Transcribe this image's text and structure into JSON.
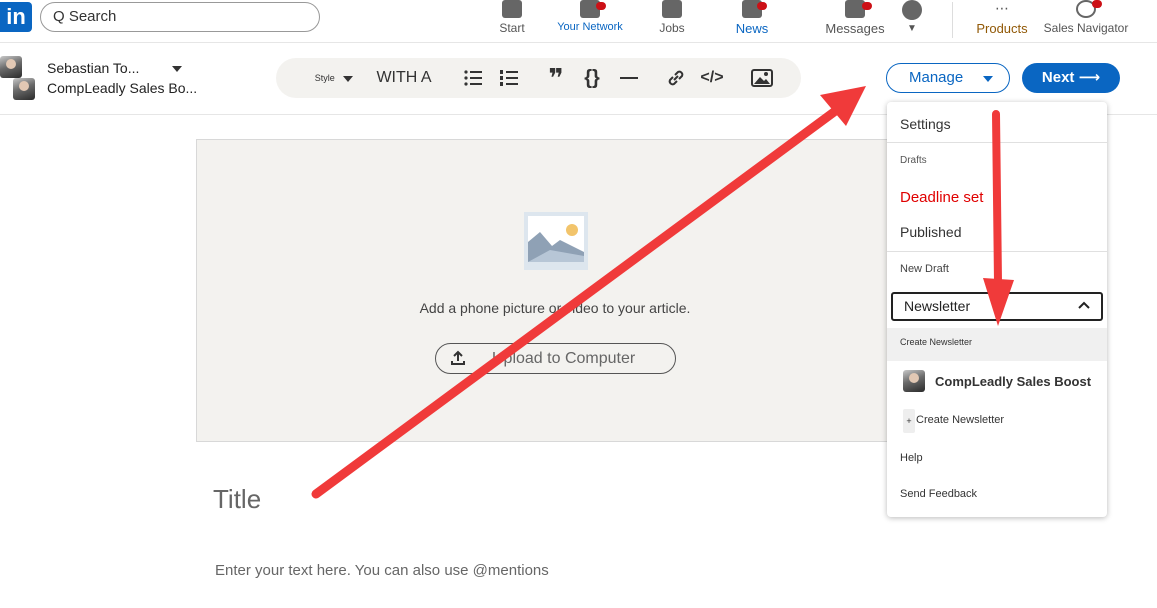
{
  "nav": {
    "logo": "in",
    "search": "Q Search",
    "items": [
      {
        "label": "Start"
      },
      {
        "label": "Your Network"
      },
      {
        "label": "Jobs"
      },
      {
        "label": "News"
      },
      {
        "label": "Messages"
      },
      {
        "label": "Products"
      },
      {
        "label": "Sales Navigator"
      }
    ]
  },
  "accounts": {
    "primary": "Sebastian To...",
    "secondary": "CompLeadly Sales Bo..."
  },
  "toolbar": {
    "style_label": "Style",
    "heading_label": "WITH A"
  },
  "header": {
    "manage_label": "Manage",
    "next_label": "Next ⟶"
  },
  "editor": {
    "media_prompt": "Add a phone picture or video to your article.",
    "upload_label": "Upload to Computer",
    "title_placeholder": "Title",
    "body_placeholder": "Enter your text here. You can also use @mentions"
  },
  "menu": {
    "settings": "Settings",
    "drafts_heading": "Drafts",
    "deadline_set": "Deadline set",
    "published": "Published",
    "new_draft": "New Draft",
    "newsletter_label": "Newsletter",
    "create_newsletter_top": "Create Newsletter",
    "newsletter_page": "CompLeadly Sales Boost",
    "create_newsletter_item": "Create Newsletter",
    "help": "Help",
    "send_feedback": "Send Feedback"
  },
  "colors": {
    "brand_blue": "#0a66c2",
    "deadline_red": "#e00000",
    "arrow_red": "#f03a3a"
  }
}
